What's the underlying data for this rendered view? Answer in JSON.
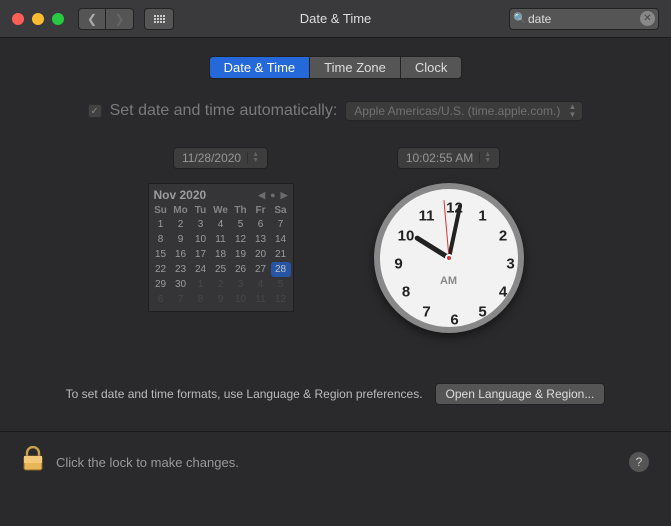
{
  "window": {
    "title": "Date & Time"
  },
  "search": {
    "value": "date"
  },
  "tabs": {
    "dt": "Date & Time",
    "tz": "Time Zone",
    "clk": "Clock"
  },
  "auto": {
    "label": "Set date and time automatically:",
    "server": "Apple Americas/U.S. (time.apple.com.)"
  },
  "date_field": "11/28/2020",
  "time_field": "10:02:55 AM",
  "calendar": {
    "month": "Nov 2020",
    "dow": [
      "Su",
      "Mo",
      "Tu",
      "We",
      "Th",
      "Fr",
      "Sa"
    ],
    "rows": [
      [
        {
          "n": "1"
        },
        {
          "n": "2"
        },
        {
          "n": "3"
        },
        {
          "n": "4"
        },
        {
          "n": "5"
        },
        {
          "n": "6"
        },
        {
          "n": "7"
        }
      ],
      [
        {
          "n": "8"
        },
        {
          "n": "9"
        },
        {
          "n": "10"
        },
        {
          "n": "11"
        },
        {
          "n": "12"
        },
        {
          "n": "13"
        },
        {
          "n": "14"
        }
      ],
      [
        {
          "n": "15"
        },
        {
          "n": "16"
        },
        {
          "n": "17"
        },
        {
          "n": "18"
        },
        {
          "n": "19"
        },
        {
          "n": "20"
        },
        {
          "n": "21"
        }
      ],
      [
        {
          "n": "22"
        },
        {
          "n": "23"
        },
        {
          "n": "24"
        },
        {
          "n": "25"
        },
        {
          "n": "26"
        },
        {
          "n": "27"
        },
        {
          "n": "28",
          "sel": true
        }
      ],
      [
        {
          "n": "29"
        },
        {
          "n": "30"
        },
        {
          "n": "1",
          "out": true
        },
        {
          "n": "2",
          "out": true
        },
        {
          "n": "3",
          "out": true
        },
        {
          "n": "4",
          "out": true
        },
        {
          "n": "5",
          "out": true
        }
      ],
      [
        {
          "n": "6",
          "out": true
        },
        {
          "n": "7",
          "out": true
        },
        {
          "n": "8",
          "out": true
        },
        {
          "n": "9",
          "out": true
        },
        {
          "n": "10",
          "out": true
        },
        {
          "n": "11",
          "out": true
        },
        {
          "n": "12",
          "out": true
        }
      ]
    ]
  },
  "clock_ampm": "AM",
  "footer": {
    "hint": "To set date and time formats, use Language & Region preferences.",
    "btn": "Open Language & Region..."
  },
  "lock": {
    "text": "Click the lock to make changes."
  }
}
